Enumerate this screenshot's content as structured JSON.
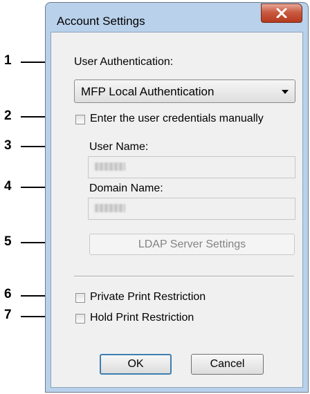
{
  "window": {
    "title": "Account Settings",
    "close_label": "x"
  },
  "form": {
    "user_authentication_label": "User Authentication:",
    "user_authentication_value": "MFP Local Authentication",
    "enter_credentials_label": "Enter the user credentials manually",
    "enter_credentials_checked": false,
    "user_name_label": "User Name:",
    "user_name_value": "",
    "domain_name_label": "Domain Name:",
    "domain_name_value": "",
    "ldap_button_label": "LDAP Server Settings",
    "private_print_label": "Private Print Restriction",
    "private_print_checked": false,
    "hold_print_label": "Hold Print Restriction",
    "hold_print_checked": false,
    "ok_label": "OK",
    "cancel_label": "Cancel"
  },
  "callouts": [
    "1",
    "2",
    "3",
    "4",
    "5",
    "6",
    "7"
  ],
  "colors": {
    "frame": "#b9d1ea",
    "close_button": "#c85a41",
    "default_button_border": "#3c7fb1"
  }
}
